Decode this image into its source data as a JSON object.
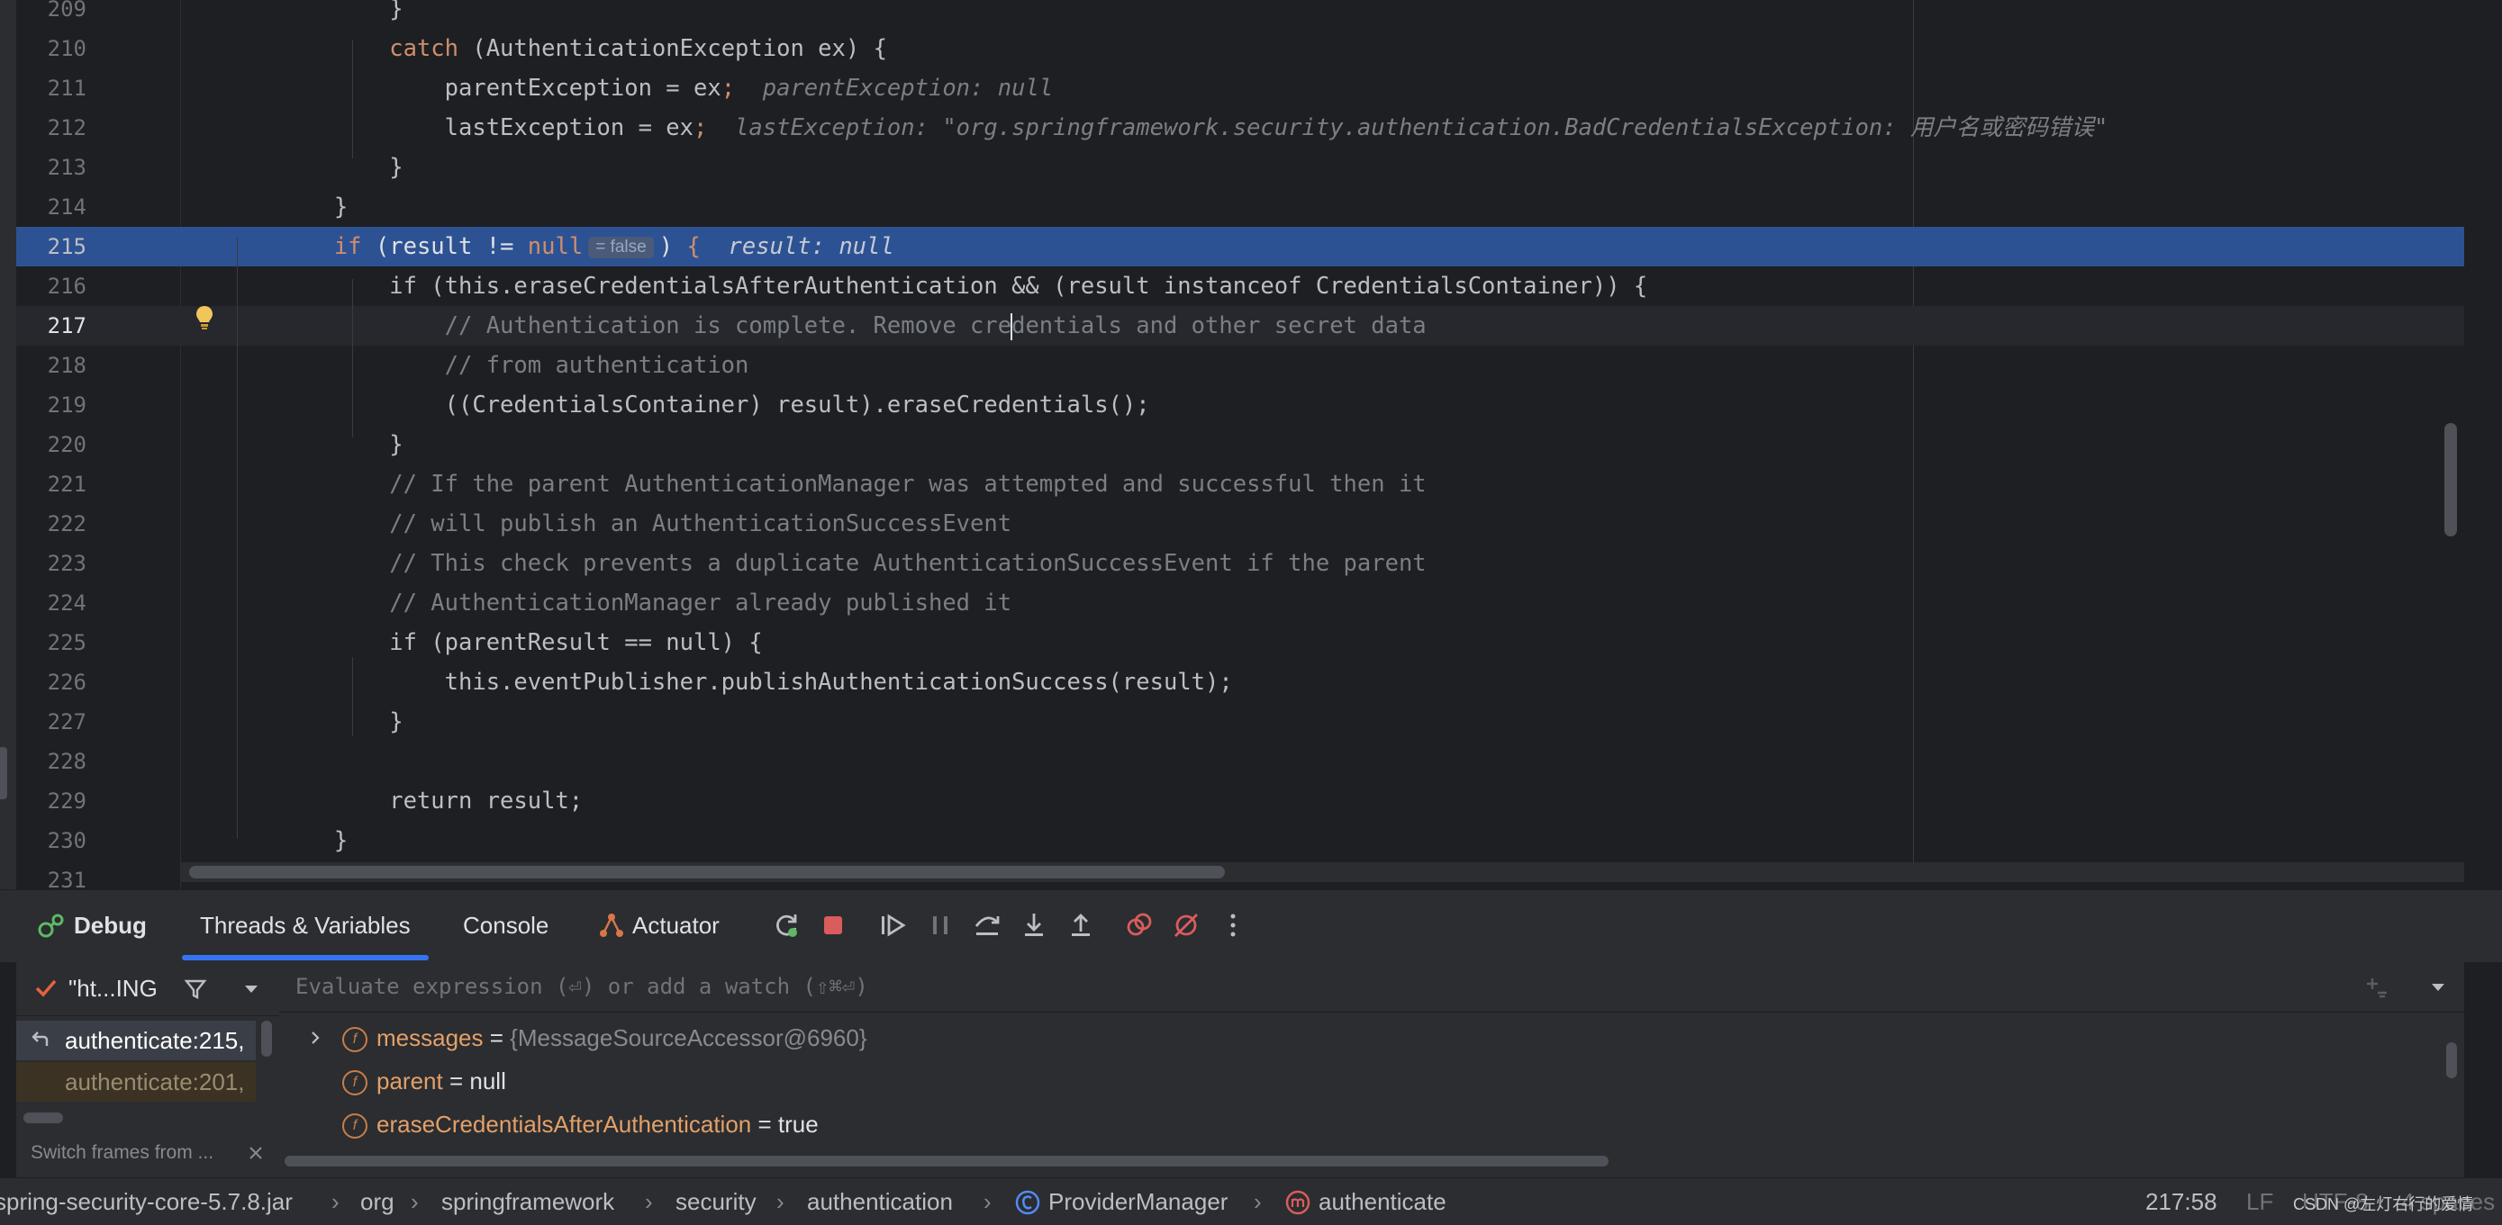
{
  "editor": {
    "lines": [
      {
        "no": "209",
        "segments": [
          {
            "t": "            }",
            "c": "plain"
          }
        ]
      },
      {
        "no": "210",
        "segments": [
          {
            "t": "            ",
            "c": "plain"
          },
          {
            "t": "catch",
            "c": "kw"
          },
          {
            "t": " (AuthenticationException ex) {",
            "c": "plain"
          }
        ]
      },
      {
        "no": "211",
        "segments": [
          {
            "t": "                parentException = ex",
            "c": "plain"
          },
          {
            "t": ";",
            "c": "kw"
          },
          {
            "t": "  parentException: null",
            "c": "hint"
          }
        ]
      },
      {
        "no": "212",
        "segments": [
          {
            "t": "                lastException = ex",
            "c": "plain"
          },
          {
            "t": ";",
            "c": "kw"
          },
          {
            "t": "  lastException: \"org.springframework.security.authentication.BadCredentialsException: 用户名或密码错误\"",
            "c": "hint"
          }
        ]
      },
      {
        "no": "213",
        "segments": [
          {
            "t": "            }",
            "c": "plain"
          }
        ]
      },
      {
        "no": "214",
        "segments": [
          {
            "t": "        }",
            "c": "plain"
          }
        ]
      },
      {
        "no": "215",
        "exec": true,
        "segments": [
          {
            "t": "        ",
            "c": "plain"
          },
          {
            "t": "if",
            "c": "kw"
          },
          {
            "t": " (result != ",
            "c": "plain"
          },
          {
            "t": "null",
            "c": "kw"
          },
          {
            "t": "= false",
            "c": "inlay"
          },
          {
            "t": ") ",
            "c": "plain"
          },
          {
            "t": "{",
            "c": "kw"
          },
          {
            "t": "  result: null",
            "c": "hint"
          }
        ]
      },
      {
        "no": "216",
        "segments": [
          {
            "t": "            if (this.eraseCredentialsAfterAuthentication && (result instanceof CredentialsContainer)) {",
            "c": "plain"
          }
        ]
      },
      {
        "no": "217",
        "caret": true,
        "segments": [
          {
            "t": "                // Authentication is complete. Remove cre",
            "c": "cm"
          },
          {
            "t": "",
            "c": "caret"
          },
          {
            "t": "dentials and other secret data",
            "c": "cm"
          }
        ]
      },
      {
        "no": "218",
        "segments": [
          {
            "t": "                // from authentication",
            "c": "cm"
          }
        ]
      },
      {
        "no": "219",
        "segments": [
          {
            "t": "                ((CredentialsContainer) result).eraseCredentials();",
            "c": "plain"
          }
        ]
      },
      {
        "no": "220",
        "segments": [
          {
            "t": "            }",
            "c": "plain"
          }
        ]
      },
      {
        "no": "221",
        "segments": [
          {
            "t": "            // If the parent AuthenticationManager was attempted and successful then it",
            "c": "cm"
          }
        ]
      },
      {
        "no": "222",
        "segments": [
          {
            "t": "            // will publish an AuthenticationSuccessEvent",
            "c": "cm"
          }
        ]
      },
      {
        "no": "223",
        "segments": [
          {
            "t": "            // This check prevents a duplicate AuthenticationSuccessEvent if the parent",
            "c": "cm"
          }
        ]
      },
      {
        "no": "224",
        "segments": [
          {
            "t": "            // AuthenticationManager already published it",
            "c": "cm"
          }
        ]
      },
      {
        "no": "225",
        "segments": [
          {
            "t": "            if (parentResult == null) {",
            "c": "plain"
          }
        ]
      },
      {
        "no": "226",
        "segments": [
          {
            "t": "                this.eventPublisher.publishAuthenticationSuccess(result);",
            "c": "plain"
          }
        ]
      },
      {
        "no": "227",
        "segments": [
          {
            "t": "            }",
            "c": "plain"
          }
        ]
      },
      {
        "no": "228",
        "segments": [
          {
            "t": "",
            "c": "plain"
          }
        ]
      },
      {
        "no": "229",
        "segments": [
          {
            "t": "            return result;",
            "c": "plain"
          }
        ]
      },
      {
        "no": "230",
        "segments": [
          {
            "t": "        }",
            "c": "plain"
          }
        ]
      },
      {
        "no": "231",
        "segments": [
          {
            "t": "",
            "c": "plain"
          }
        ]
      }
    ]
  },
  "debug_toolbar": {
    "debug_label": "Debug",
    "threads_vars_label": "Threads & Variables",
    "console_label": "Console",
    "actuator_label": "Actuator",
    "icons": [
      "rerun-icon",
      "stop-icon",
      "resume-icon",
      "pause-icon",
      "step-over-icon",
      "step-into-icon",
      "step-out-icon",
      "view-breakpoints-icon",
      "mute-breakpoints-icon",
      "more-icon"
    ]
  },
  "threads": {
    "current_thread": "\"ht...ING",
    "frames": [
      "authenticate:215,",
      "authenticate:201,"
    ],
    "switch_frames": "Switch frames from ..."
  },
  "variables": {
    "eval_placeholder": "Evaluate expression (⏎) or add a watch (⇧⌘⏎)",
    "rows": [
      {
        "name": "messages",
        "eq": " = ",
        "value": "{MessageSourceAccessor@6960}",
        "expandable": true
      },
      {
        "name": "parent",
        "eq": " = ",
        "value": "null",
        "expandable": false
      },
      {
        "name": "eraseCredentialsAfterAuthentication",
        "eq": " = ",
        "value": "true",
        "expandable": false
      }
    ]
  },
  "statusbar": {
    "crumbs": [
      "spring-security-core-5.7.8.jar",
      "org",
      "springframework",
      "security",
      "authentication",
      "ProviderManager",
      "authenticate"
    ],
    "position": "217:58",
    "line_sep": "LF",
    "encoding": "UTF-8",
    "indent": "4 spaces",
    "watermark": "CSDN @左灯右行的爱情"
  },
  "colors": {
    "editor_bg": "#1e1f22",
    "panel_bg": "#2b2d30",
    "exec_line": "#2d5293",
    "keyword": "#cf8e6d",
    "comment": "#7a7e85",
    "field_name": "#e2a069",
    "accent": "#3574f0"
  }
}
